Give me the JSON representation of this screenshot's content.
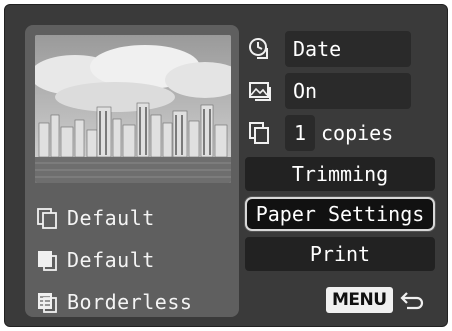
{
  "settings": {
    "date": {
      "icon": "clock-icon",
      "value": "Date"
    },
    "file_no": {
      "icon": "image-icon",
      "value": "On"
    },
    "copies": {
      "icon": "copies-icon",
      "count": "1",
      "label": "copies"
    }
  },
  "menu": {
    "trimming": "Trimming",
    "paper_settings": "Paper Settings",
    "print": "Print",
    "selected": "Paper Settings"
  },
  "paper": {
    "size": {
      "icon": "paper-size-icon",
      "value": "Default"
    },
    "type": {
      "icon": "paper-type-icon",
      "value": "Default"
    },
    "layout": {
      "icon": "paper-layout-icon",
      "value": "Borderless"
    }
  },
  "footer": {
    "menu_label": "MENU",
    "back_icon": "back-arrow-icon"
  },
  "colors": {
    "screen_bg": "#3a3a3a",
    "panel_bg": "#5f5f5f",
    "button_bg": "#222222",
    "text": "#ffffff"
  }
}
